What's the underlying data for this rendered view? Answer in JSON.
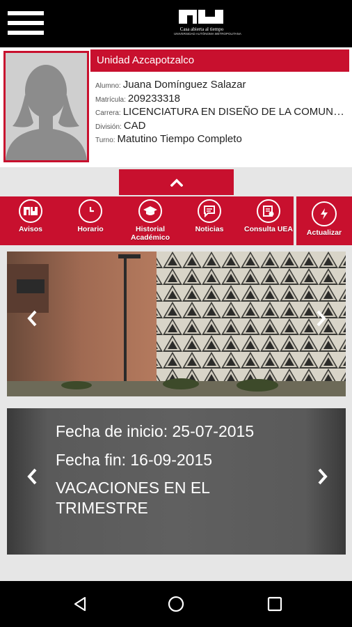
{
  "header": {
    "logo_tagline": "Casa abierta al tiempo",
    "logo_subtitle": "UNIVERSIDAD AUTÓNOMA METROPOLITANA"
  },
  "profile": {
    "unit": "Unidad Azcapotzalco",
    "fields": [
      {
        "label": "Alumno:",
        "value": "Juana Domínguez Salazar"
      },
      {
        "label": "Matrícula:",
        "value": "209233318"
      },
      {
        "label": "Carrera:",
        "value": "LICENCIATURA EN DISEÑO DE LA COMUNICACIÓN GRÁFICA"
      },
      {
        "label": "División:",
        "value": "CAD"
      },
      {
        "label": "Turno:",
        "value": "Matutino  Tiempo Completo"
      }
    ]
  },
  "menu": {
    "items": [
      {
        "label": "Avisos",
        "icon": "uam-logo-icon"
      },
      {
        "label": "Horario",
        "icon": "clock-icon"
      },
      {
        "label": "Historial Académico",
        "icon": "graduation-cap-icon"
      },
      {
        "label": "Noticias",
        "icon": "chat-bubble-icon"
      },
      {
        "label": "Consulta UEA",
        "icon": "document-icon"
      },
      {
        "label": "Actualizar",
        "icon": "refresh-bolt-icon"
      }
    ]
  },
  "event": {
    "start": "Fecha de inicio: 25-07-2015",
    "end": "Fecha fin: 16-09-2015",
    "title": "VACACIONES EN EL TRIMESTRE"
  },
  "colors": {
    "accent": "#c8102e",
    "topbar": "#000000",
    "background": "#e6e6e6"
  }
}
